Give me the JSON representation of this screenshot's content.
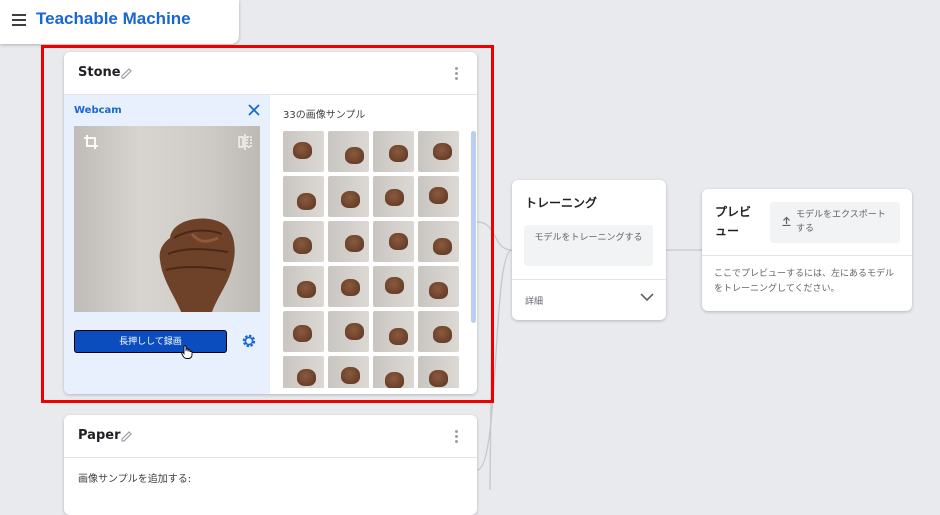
{
  "app": {
    "title": "Teachable Machine"
  },
  "classes": [
    {
      "name": "Stone",
      "webcam": {
        "title": "Webcam",
        "record_label": "長押しして録画"
      },
      "samples": {
        "title": "33の画像サンプル",
        "count": 33
      }
    },
    {
      "name": "Paper",
      "add_samples_label": "画像サンプルを追加する:"
    }
  ],
  "training": {
    "title": "トレーニング",
    "train_button_label": "モデルをトレーニングする",
    "details_label": "詳細"
  },
  "preview": {
    "title": "プレビュー",
    "export_button_label": "モデルをエクスポートする",
    "hint": "ここでプレビューするには、左にあるモデルをトレーニングしてください。"
  },
  "colors": {
    "accent": "#1967d2",
    "record_button": "#0b4dbf",
    "webcam_panel": "#e8f0fe",
    "highlight": "#ee0000",
    "background": "#e8eaed"
  },
  "icons": [
    "menu-icon",
    "pencil-icon",
    "kebab-icon",
    "close-icon",
    "crop-icon",
    "flip-icon",
    "settings-icon",
    "chevron-down-icon",
    "upload-icon",
    "cursor-icon"
  ]
}
